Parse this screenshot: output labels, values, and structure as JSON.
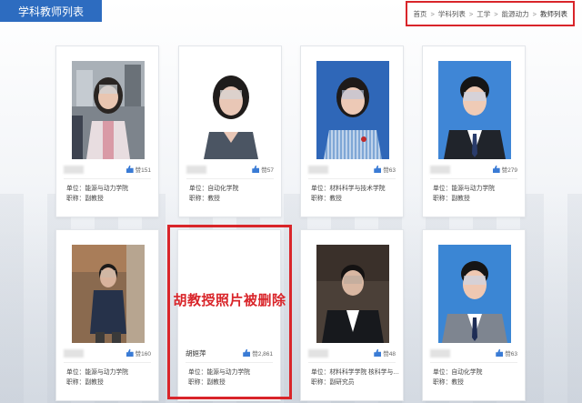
{
  "header": {
    "tab_label": "学科教师列表"
  },
  "breadcrumb": [
    "首页",
    "学科列表",
    "工学",
    "能源动力",
    "教师列表"
  ],
  "breadcrumb_separator": ">",
  "cards": [
    {
      "name": "",
      "likes": "赞151",
      "unit": "单位：能源与动力学院",
      "title": "职称：副教授"
    },
    {
      "name": "",
      "likes": "赞57",
      "unit": "单位：自动化学院",
      "title": "职称：教授"
    },
    {
      "name": "",
      "likes": "赞63",
      "unit": "单位：材料科学与技术学院",
      "title": "职称：教授"
    },
    {
      "name": "",
      "likes": "赞279",
      "unit": "单位：能源与动力学院",
      "title": "职称：副教授"
    },
    {
      "name": "",
      "likes": "赞160",
      "unit": "单位：能源与动力学院",
      "title": "职称：副教授"
    },
    {
      "name": "胡姮萍",
      "likes": "赞2,861",
      "unit": "单位：能源与动力学院",
      "title": "职称：副教授",
      "annotation": "胡教授照片被删除"
    },
    {
      "name": "",
      "likes": "赞48",
      "unit": "单位：材料科学学院 核科学与技术...",
      "title": "职称：副研究员"
    },
    {
      "name": "",
      "likes": "赞63",
      "unit": "单位：自动化学院",
      "title": "职称：教授"
    }
  ],
  "colors": {
    "accent": "#2d6cc0",
    "highlight_red": "#d9252a",
    "like_blue": "#3a7bd5"
  }
}
